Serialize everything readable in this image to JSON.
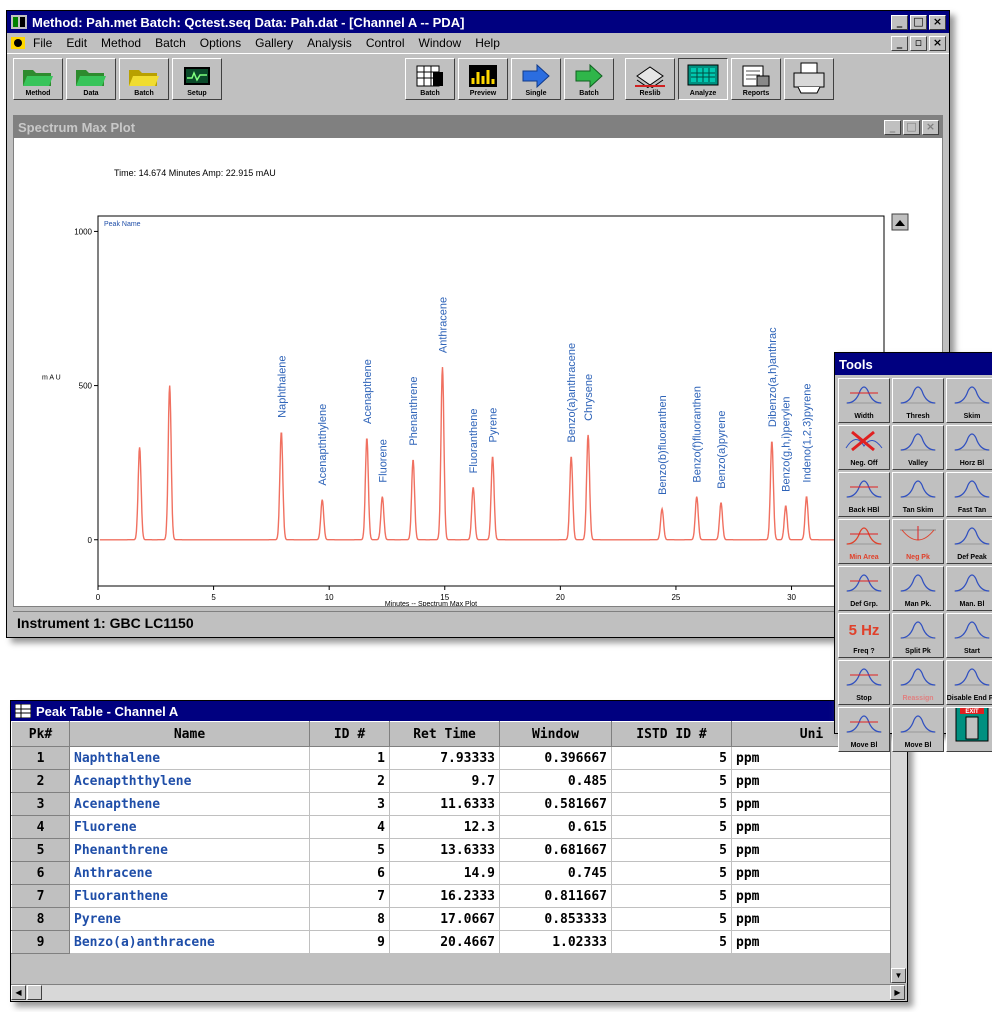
{
  "main_window": {
    "title": "Method: Pah.met   Batch: Qctest.seq   Data: Pah.dat - [Channel A -- PDA]",
    "menu": [
      "File",
      "Edit",
      "Method",
      "Batch",
      "Options",
      "Gallery",
      "Analysis",
      "Control",
      "Window",
      "Help"
    ],
    "toolbar": [
      {
        "label": "Method",
        "icon": "folder-open-icon"
      },
      {
        "label": "Data",
        "icon": "folder-open-icon"
      },
      {
        "label": "Batch",
        "icon": "folder-open-icon"
      },
      {
        "label": "Setup",
        "icon": "setup-monitor-icon"
      },
      {
        "label": "Batch",
        "icon": "batch-grid-icon"
      },
      {
        "label": "Preview",
        "icon": "preview-chart-icon"
      },
      {
        "label": "Single",
        "icon": "run-arrow-icon"
      },
      {
        "label": "Batch",
        "icon": "run-arrow-icon"
      },
      {
        "label": "Reslib",
        "icon": "reslib-icon"
      },
      {
        "label": "Analyze",
        "icon": "analyze-icon"
      },
      {
        "label": "Reports",
        "icon": "reports-icon"
      },
      {
        "label": "",
        "icon": "printer-icon"
      }
    ],
    "status": "Instrument 1: GBC LC1150"
  },
  "spectrum_window": {
    "title": "Spectrum Max Plot",
    "readout": "Time: 14.674 Minutes  Amp:   22.915 mAU",
    "legend_title": "Peak Name"
  },
  "chart_data": {
    "type": "line",
    "xlabel": "Minutes -- Spectrum Max Plot",
    "ylabel": "m A U",
    "xlim": [
      0,
      34
    ],
    "ylim": [
      -150,
      1050
    ],
    "x_ticks": [
      0,
      5,
      10,
      15,
      20,
      25,
      30
    ],
    "y_ticks": [
      0,
      500,
      1000
    ],
    "color": "#f07060",
    "peaks": [
      {
        "name": "",
        "x": 1.8,
        "y": 300
      },
      {
        "name": "",
        "x": 3.1,
        "y": 500
      },
      {
        "name": "Naphthalene",
        "x": 7.93,
        "y": 350
      },
      {
        "name": "Acenapththylene",
        "x": 9.7,
        "y": 130
      },
      {
        "name": "Acenapthene",
        "x": 11.63,
        "y": 330
      },
      {
        "name": "Fluorene",
        "x": 12.3,
        "y": 140
      },
      {
        "name": "Phenanthrene",
        "x": 13.63,
        "y": 260
      },
      {
        "name": "Anthracene",
        "x": 14.9,
        "y": 560
      },
      {
        "name": "Fluoranthene",
        "x": 16.23,
        "y": 170
      },
      {
        "name": "Pyrene",
        "x": 17.07,
        "y": 270
      },
      {
        "name": "Benzo(a)anthracene",
        "x": 20.47,
        "y": 270
      },
      {
        "name": "Chrysene",
        "x": 21.2,
        "y": 340
      },
      {
        "name": "Benzo(b)fluoranthen",
        "x": 24.4,
        "y": 100
      },
      {
        "name": "Benzo(f)fluoranthen",
        "x": 25.9,
        "y": 140
      },
      {
        "name": "Benzo(a)pyrene",
        "x": 26.95,
        "y": 120
      },
      {
        "name": "Dibenzo(a,h)anthrac",
        "x": 29.15,
        "y": 320
      },
      {
        "name": "Benzo(g,h,i)perylen",
        "x": 29.75,
        "y": 110
      },
      {
        "name": "Indeno(1,2,3)pyrene",
        "x": 30.65,
        "y": 140
      }
    ]
  },
  "peak_table": {
    "title": "Peak Table - Channel A",
    "columns": [
      "Pk#",
      "Name",
      "ID #",
      "Ret Time",
      "Window",
      "ISTD ID #",
      "Uni"
    ],
    "rows": [
      [
        "1",
        "Naphthalene",
        "1",
        "7.93333",
        "0.396667",
        "5",
        "ppm"
      ],
      [
        "2",
        "Acenapththylene",
        "2",
        "9.7",
        "0.485",
        "5",
        "ppm"
      ],
      [
        "3",
        "Acenapthene",
        "3",
        "11.6333",
        "0.581667",
        "5",
        "ppm"
      ],
      [
        "4",
        "Fluorene",
        "4",
        "12.3",
        "0.615",
        "5",
        "ppm"
      ],
      [
        "5",
        "Phenanthrene",
        "5",
        "13.6333",
        "0.681667",
        "5",
        "ppm"
      ],
      [
        "6",
        "Anthracene",
        "6",
        "14.9",
        "0.745",
        "5",
        "ppm"
      ],
      [
        "7",
        "Fluoranthene",
        "7",
        "16.2333",
        "0.811667",
        "5",
        "ppm"
      ],
      [
        "8",
        "Pyrene",
        "8",
        "17.0667",
        "0.853333",
        "5",
        "ppm"
      ],
      [
        "9",
        "Benzo(a)anthracene",
        "9",
        "20.4667",
        "1.02333",
        "5",
        "ppm"
      ]
    ]
  },
  "tools": {
    "title": "Tools",
    "items": [
      {
        "label": "Width",
        "icon": "width-icon",
        "color": "#000000"
      },
      {
        "label": "Thresh",
        "icon": "threshold-icon",
        "color": "#000000"
      },
      {
        "label": "Skim",
        "icon": "skim-icon",
        "color": "#000000"
      },
      {
        "label": "Neg. Off",
        "icon": "negative-off-icon",
        "color": "#000000"
      },
      {
        "label": "Valley",
        "icon": "valley-icon",
        "color": "#000000"
      },
      {
        "label": "Horz Bl",
        "icon": "horizontal-baseline-icon",
        "color": "#000000"
      },
      {
        "label": "Back HBl",
        "icon": "back-baseline-icon",
        "color": "#000000"
      },
      {
        "label": "Tan Skim",
        "icon": "tangent-skim-icon",
        "color": "#000000"
      },
      {
        "label": "Fast Tan",
        "icon": "fast-tangent-icon",
        "color": "#000000"
      },
      {
        "label": "Min Area",
        "icon": "min-area-icon",
        "color": "#e0402a"
      },
      {
        "label": "Neg Pk",
        "icon": "negative-peak-icon",
        "color": "#e0402a"
      },
      {
        "label": "Def Peak",
        "icon": "define-peak-icon",
        "color": "#000000"
      },
      {
        "label": "Def Grp.",
        "icon": "define-group-icon",
        "color": "#000000"
      },
      {
        "label": "Man Pk.",
        "icon": "manual-peak-icon",
        "color": "#000000"
      },
      {
        "label": "Man. Bl",
        "icon": "manual-baseline-icon",
        "color": "#000000"
      },
      {
        "label": "Freq ?",
        "icon": "frequency-icon",
        "color": "#000000"
      },
      {
        "label": "Split Pk",
        "icon": "split-peak-icon",
        "color": "#000000"
      },
      {
        "label": "Start",
        "icon": "start-icon",
        "color": "#000000"
      },
      {
        "label": "Stop",
        "icon": "stop-icon",
        "color": "#000000"
      },
      {
        "label": "Reassign",
        "icon": "reassign-icon",
        "color": "#e08080"
      },
      {
        "label": "Disable End Pk",
        "icon": "disable-end-peak-icon",
        "color": "#000000"
      },
      {
        "label": "Move Bl",
        "icon": "move-baseline-icon",
        "color": "#000000"
      },
      {
        "label": "Move Bl",
        "icon": "move-baseline-icon",
        "color": "#000000"
      },
      {
        "label": "",
        "icon": "exit-door-icon",
        "color": "#000000"
      }
    ],
    "freq_text": "5 Hz",
    "exit_text": "EXIT"
  }
}
